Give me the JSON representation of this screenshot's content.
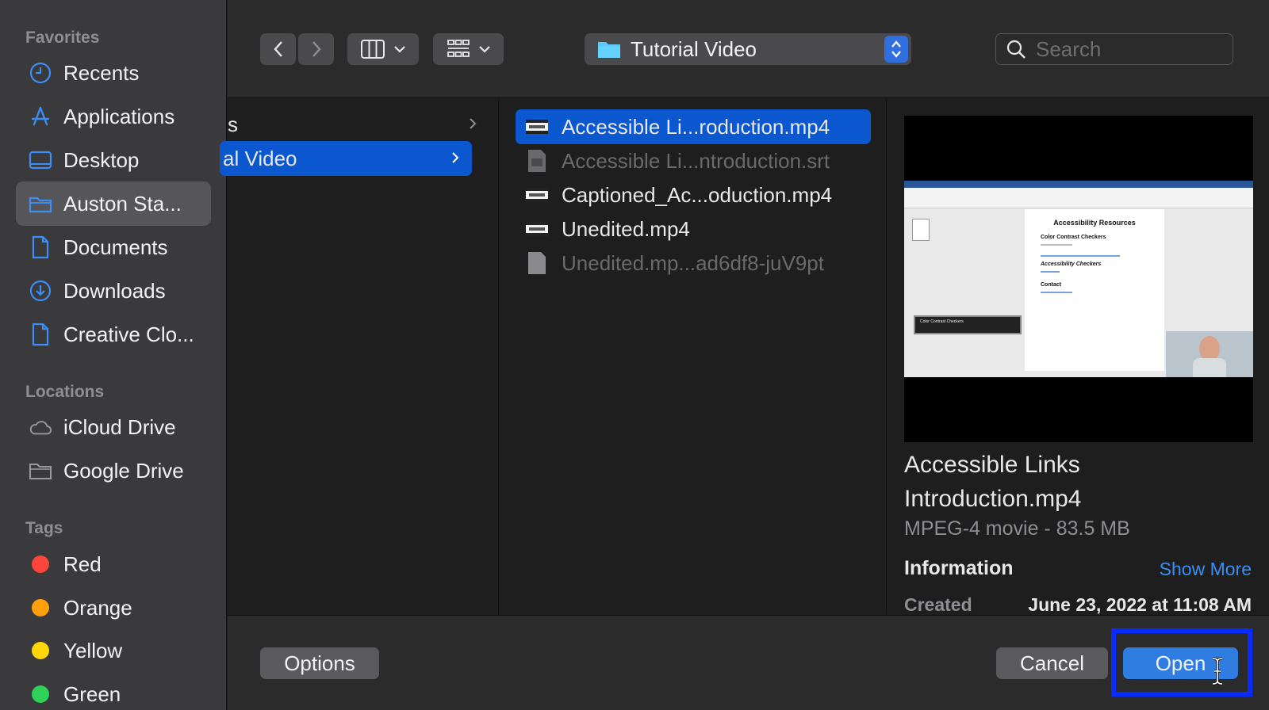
{
  "sidebar": {
    "favorites_heading": "Favorites",
    "favorites": [
      {
        "label": "Recents",
        "icon": "clock-icon"
      },
      {
        "label": "Applications",
        "icon": "applications-icon"
      },
      {
        "label": "Desktop",
        "icon": "desktop-icon"
      },
      {
        "label": "Auston Sta...",
        "icon": "folder-icon"
      },
      {
        "label": "Documents",
        "icon": "document-icon"
      },
      {
        "label": "Downloads",
        "icon": "download-icon"
      },
      {
        "label": "Creative Clo...",
        "icon": "document-icon"
      }
    ],
    "locations_heading": "Locations",
    "locations": [
      {
        "label": "iCloud Drive",
        "icon": "cloud-icon"
      },
      {
        "label": "Google Drive",
        "icon": "folder-icon"
      }
    ],
    "tags_heading": "Tags",
    "tags": [
      {
        "label": "Red",
        "color": "#ff453a"
      },
      {
        "label": "Orange",
        "color": "#ff9f0a"
      },
      {
        "label": "Yellow",
        "color": "#ffd60a"
      },
      {
        "label": "Green",
        "color": "#30d158"
      }
    ]
  },
  "toolbar": {
    "path_label": "Tutorial Video",
    "search_placeholder": "Search"
  },
  "columns": {
    "col1": [
      {
        "label": "s"
      },
      {
        "label": "al Video"
      }
    ],
    "col2": [
      {
        "label": "Accessible Li...roduction.mp4"
      },
      {
        "label": "Accessible Li...ntroduction.srt"
      },
      {
        "label": "Captioned_Ac...oduction.mp4"
      },
      {
        "label": "Unedited.mp4"
      },
      {
        "label": "Unedited.mp...ad6df8-juV9pt"
      }
    ]
  },
  "preview": {
    "thumb_doc_title": "Accessibility Resources",
    "thumb_heading1": "Color Contrast Checkers",
    "thumb_heading2": "Accessibility Checkers",
    "thumb_heading3": "Contact",
    "thumb_caption": "Color Contrast Checkers",
    "name": "Accessible Links Introduction.mp4",
    "kind": "MPEG-4 movie - 83.5 MB",
    "info_label": "Information",
    "show_more": "Show More",
    "created_label": "Created",
    "created_value": "June 23, 2022 at 11:08 AM"
  },
  "bottom": {
    "options": "Options",
    "cancel": "Cancel",
    "open": "Open"
  },
  "colors": {
    "accent": "#0b57d0",
    "link": "#3a8ef6",
    "focus": "#0a2bff"
  }
}
